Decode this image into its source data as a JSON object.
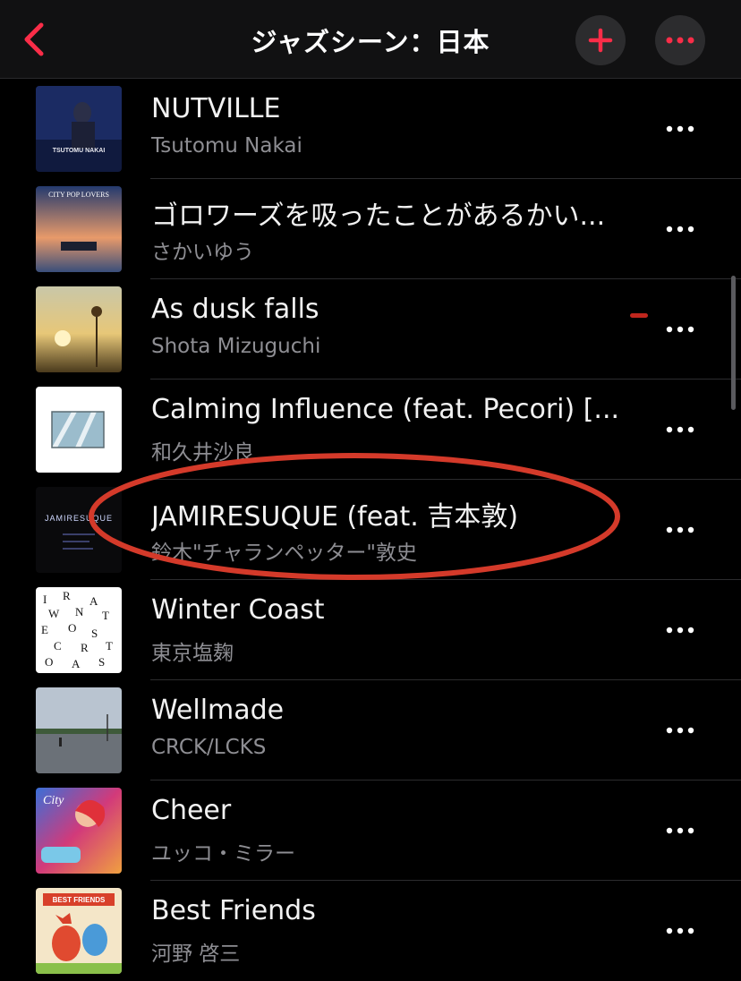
{
  "header": {
    "title": "ジャズシーン：日本",
    "back_icon": "chevron-left-icon",
    "add_icon": "plus-icon",
    "more_icon": "ellipsis-icon",
    "accent_color": "#fa2d48"
  },
  "tracks": [
    {
      "title": "NUTVILLE",
      "artist": "Tsutomu Nakai",
      "art_text": "TSUTOMU NAKAI"
    },
    {
      "title": "ゴロワーズを吸ったことがあるかい...",
      "artist": "さかいゆう",
      "art_text": "CITY POP LOVERS"
    },
    {
      "title": "As dusk falls",
      "artist": "Shota Mizuguchi",
      "art_text": ""
    },
    {
      "title": "Calming Influence (feat. Pecori) [...",
      "artist": "和久井沙良",
      "art_text": ""
    },
    {
      "title": "JAMIRESUQUE (feat. 吉本敦)",
      "artist": "鈴木\"チャランペッター\"敦史",
      "art_text": "JAMIRESUQUE"
    },
    {
      "title": "Winter Coast",
      "artist": "東京塩麹",
      "art_text": ""
    },
    {
      "title": "Wellmade",
      "artist": "CRCK/LCKS",
      "art_text": ""
    },
    {
      "title": "Cheer",
      "artist": "ユッコ・ミラー",
      "art_text": "City"
    },
    {
      "title": "Best Friends",
      "artist": "河野 啓三",
      "art_text": "BEST FRIENDS"
    }
  ],
  "annotation": {
    "highlighted_track": "JAMIRESUQUE (feat. 吉本敦)",
    "color": "#d43a2a"
  }
}
